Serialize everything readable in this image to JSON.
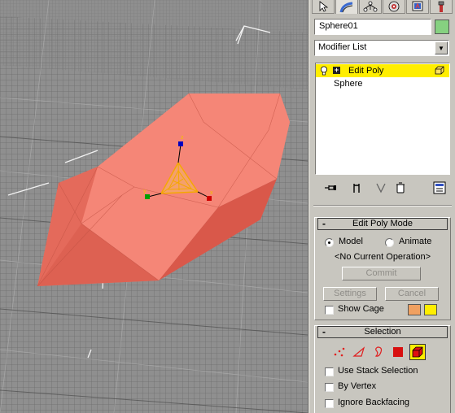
{
  "command_panel": {
    "tabs": [
      {
        "name": "create-tab-icon"
      },
      {
        "name": "modify-tab-icon"
      },
      {
        "name": "hierarchy-tab-icon"
      },
      {
        "name": "motion-tab-icon"
      },
      {
        "name": "display-tab-icon"
      },
      {
        "name": "utilities-tab-icon"
      }
    ],
    "active_tab": 1,
    "object_name": "Sphere01",
    "object_color": "#86d180",
    "modifier_list": "Modifier List"
  },
  "modifier_stack": {
    "items": [
      {
        "label": "Edit Poly",
        "selected": true
      },
      {
        "label": "Sphere",
        "selected": false
      }
    ]
  },
  "stack_toolbar": {
    "buttons": [
      "pin-stack-icon",
      "show-end-result-icon",
      "make-unique-icon",
      "remove-modifier-icon",
      "configure-modifier-sets-icon"
    ]
  },
  "edit_poly_mode": {
    "title": "Edit Poly Mode",
    "model_label": "Model",
    "animate_label": "Animate",
    "mode": "Model",
    "current_operation": "<No Current Operation>",
    "commit_label": "Commit",
    "settings_label": "Settings",
    "cancel_label": "Cancel",
    "show_cage_label": "Show Cage",
    "show_cage": false,
    "cage_colors": [
      "#f0a060",
      "#ffee00"
    ]
  },
  "selection": {
    "title": "Selection",
    "levels": [
      "vertex-icon",
      "edge-icon",
      "border-icon",
      "polygon-icon",
      "element-icon"
    ],
    "active_level": "element-icon",
    "use_stack_selection_label": "Use Stack Selection",
    "by_vertex_label": "By Vertex",
    "ignore_backfacing_label": "Ignore Backfacing",
    "use_stack_selection": false,
    "by_vertex": false,
    "ignore_backfacing": false
  },
  "viewport": {
    "object_color": "#f07868",
    "gizmo_axes": [
      "z",
      "y",
      "x"
    ]
  }
}
